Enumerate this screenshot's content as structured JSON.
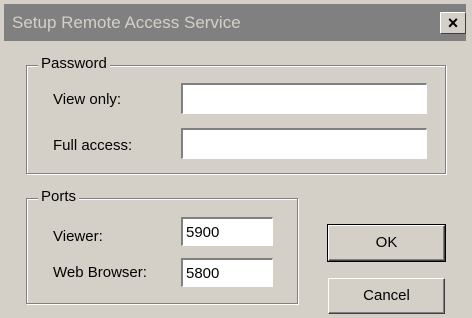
{
  "window": {
    "title": "Setup Remote Access Service",
    "close_glyph": "✕",
    "close_icon": "close-icon"
  },
  "password_group": {
    "legend": "Password",
    "view_only_label": "View only:",
    "view_only_value": "",
    "full_access_label": "Full access:",
    "full_access_value": ""
  },
  "ports_group": {
    "legend": "Ports",
    "viewer_label": "Viewer:",
    "viewer_value": "5900",
    "web_browser_label": "Web Browser:",
    "web_browser_value": "5800"
  },
  "buttons": {
    "ok_label": "OK",
    "cancel_label": "Cancel"
  },
  "colors": {
    "dialog_face": "#d4d0c8",
    "titlebar_inactive": "#808080",
    "title_text": "#d4d0c8"
  }
}
